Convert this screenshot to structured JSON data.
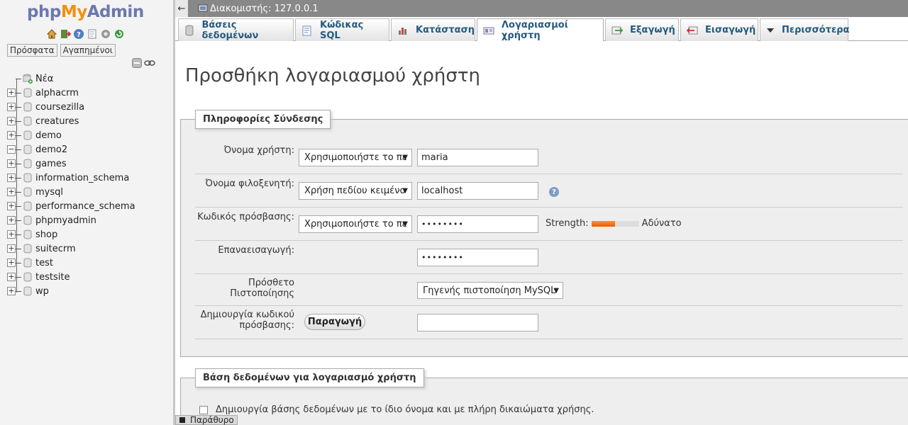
{
  "nav": {
    "logo": {
      "php": "php",
      "my": "My",
      "admin": "Admin"
    },
    "icons": [
      "home-icon",
      "exit-icon",
      "help-icon",
      "docs-icon",
      "settings-icon",
      "reload-icon"
    ],
    "tabs": [
      "Πρόσφατα",
      "Αγαπημένοι"
    ],
    "tree": [
      {
        "label": "Νέα",
        "type": "new"
      },
      {
        "label": "alphacrm"
      },
      {
        "label": "coursezilla"
      },
      {
        "label": "creatures"
      },
      {
        "label": "demo"
      },
      {
        "label": "demo2",
        "expanded": true
      },
      {
        "label": "games"
      },
      {
        "label": "information_schema"
      },
      {
        "label": "mysql"
      },
      {
        "label": "performance_schema"
      },
      {
        "label": "phpmyadmin"
      },
      {
        "label": "shop"
      },
      {
        "label": "suitecrm"
      },
      {
        "label": "test"
      },
      {
        "label": "testsite"
      },
      {
        "label": "wp"
      }
    ]
  },
  "topbar": {
    "back": "←",
    "server": "Διακομιστής: 127.0.0.1"
  },
  "tabs": [
    {
      "label": "Βάσεις δεδομένων",
      "icon": "database-icon"
    },
    {
      "label": "Κώδικας SQL",
      "icon": "sql-icon"
    },
    {
      "label": "Κατάσταση",
      "icon": "status-icon"
    },
    {
      "label": "Λογαριασμοί χρήστη",
      "icon": "users-icon",
      "active": true
    },
    {
      "label": "Εξαγωγή",
      "icon": "export-icon"
    },
    {
      "label": "Εισαγωγή",
      "icon": "import-icon"
    },
    {
      "label": "Περισσότερα",
      "icon": "more-icon"
    }
  ],
  "main": {
    "title": "Προσθήκη λογαριασμού χρήστη",
    "login": {
      "legend": "Πληροφορίες Σύνδεσης",
      "username_label": "Όνομα χρήστη:",
      "username_select": "Χρησιμοποιήστε το πε",
      "username_value": "maria",
      "host_label": "Όνομα φιλοξενητή:",
      "host_select": "Χρήση πεδίου κειμένο",
      "host_value": "localhost",
      "password_label": "Κωδικός πρόσβασης:",
      "password_select": "Χρησιμοποιήστε το πε",
      "password_value": "••••••••",
      "strength_label": "Strength:",
      "strength_level": 0.5,
      "strength_text": "Αδύνατο",
      "retype_label": "Επαναεισαγωγή:",
      "retype_value": "••••••••",
      "auth_label_1": "Πρόσθετο",
      "auth_label_2": "Πιστοποίησης",
      "auth_select": "Γηγενής πιστοποίηση MySQL",
      "gen_label_1": "Δημιουργία κωδικού",
      "gen_label_2": "πρόσβασης:",
      "gen_button": "Παραγωγή",
      "gen_value": ""
    },
    "database": {
      "legend": "Βάση δεδομένων για λογαριασμό χρήστη",
      "option_1": "Δημιουργία βάσης δεδομένων με το ίδιο όνομα και με πλήρη δικαιώματα χρήσης."
    }
  },
  "console": {
    "label": "Παράθυρο"
  }
}
